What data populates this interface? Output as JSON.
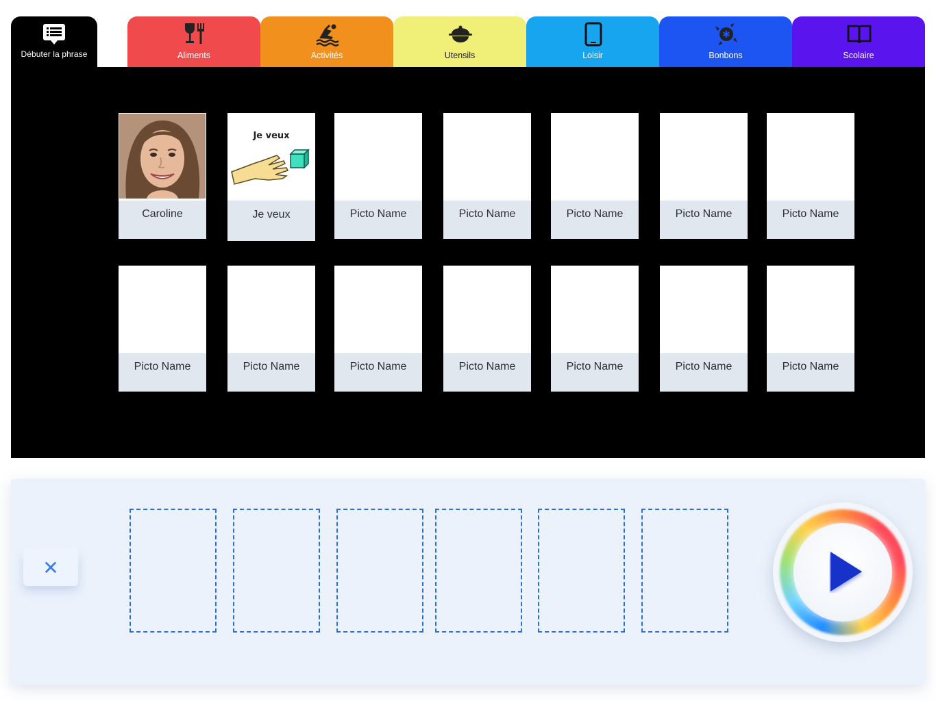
{
  "start_tab": {
    "label": "Débuter la phrase",
    "icon": "message-list-icon"
  },
  "categories": [
    {
      "label": "Aliments",
      "icon": "food-drink-icon",
      "color": "#f14a4c",
      "text_color": "#ffffff"
    },
    {
      "label": "Activités",
      "icon": "activity-icon",
      "color": "#f2901e",
      "text_color": "#ffffff"
    },
    {
      "label": "Utensils",
      "icon": "cooking-pot-icon",
      "color": "#f0ef78",
      "text_color": "#1a1a1a"
    },
    {
      "label": "Loisir",
      "icon": "tablet-icon",
      "color": "#18a5ef",
      "text_color": "#ffffff"
    },
    {
      "label": "Bonbons",
      "icon": "candy-icon",
      "color": "#1c55f2",
      "text_color": "#ffffff"
    },
    {
      "label": "Scolaire",
      "icon": "open-book-icon",
      "color": "#5a14ee",
      "text_color": "#ffffff"
    }
  ],
  "board": {
    "rows": [
      [
        {
          "name": "Caroline",
          "image": "person-photo"
        },
        {
          "name": "Je veux",
          "image": "je-veux-pictogram",
          "caption": "Je veux"
        },
        {
          "name": "Picto Name",
          "image": ""
        },
        {
          "name": "Picto Name",
          "image": ""
        },
        {
          "name": "Picto Name",
          "image": ""
        },
        {
          "name": "Picto Name",
          "image": ""
        },
        {
          "name": "Picto Name",
          "image": ""
        }
      ],
      [
        {
          "name": "Picto Name",
          "image": ""
        },
        {
          "name": "Picto Name",
          "image": ""
        },
        {
          "name": "Picto Name",
          "image": ""
        },
        {
          "name": "Picto Name",
          "image": ""
        },
        {
          "name": "Picto Name",
          "image": ""
        },
        {
          "name": "Picto Name",
          "image": ""
        },
        {
          "name": "Picto Name",
          "image": ""
        }
      ]
    ]
  },
  "sentence_strip": {
    "clear_icon": "close-icon",
    "clear_symbol": "✕",
    "slot_count": 6,
    "play_icon": "play-icon"
  },
  "colors": {
    "board_bg": "#000000",
    "card_label_bg": "#e1e7ef",
    "strip_bg": "#ebf2fc",
    "slot_border": "#2c6fd6",
    "play_triangle": "#1432c8"
  }
}
